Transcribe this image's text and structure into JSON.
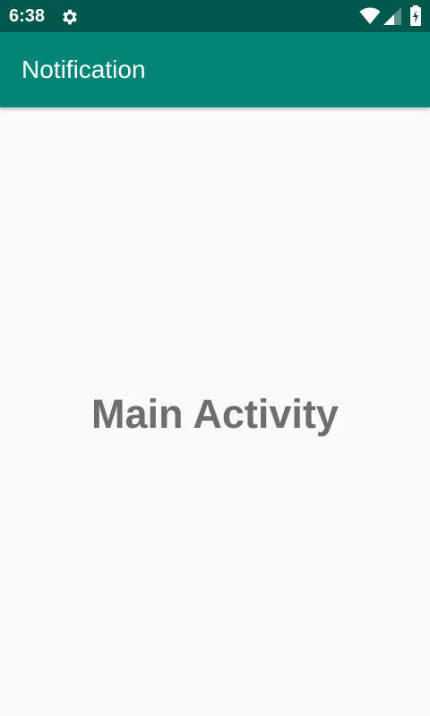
{
  "status_bar": {
    "time": "6:38",
    "icons": [
      "gear-icon",
      "wifi-icon",
      "cell-signal-icon",
      "battery-charging-icon"
    ],
    "background": "#00574b"
  },
  "app_bar": {
    "title": "Notification",
    "background": "#008577"
  },
  "main": {
    "text": "Main Activity",
    "text_color": "#6e6e6e",
    "background": "#fafafa"
  }
}
